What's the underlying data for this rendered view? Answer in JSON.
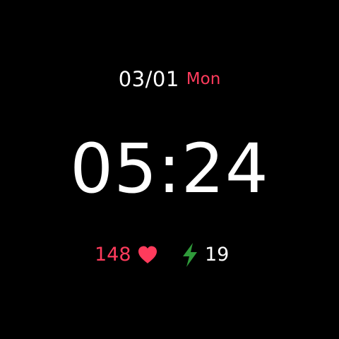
{
  "watch_face": {
    "date": "03/01",
    "weekday": "Mon",
    "time": "05:24",
    "heart_rate": "148",
    "heart_icon": "heart-icon",
    "battery": "19",
    "battery_icon": "lightning-bolt-icon"
  },
  "colors": {
    "background": "#000000",
    "primary_text": "#ffffff",
    "accent_red": "#ff3b5c",
    "bolt_green": "#2f9a3a"
  }
}
